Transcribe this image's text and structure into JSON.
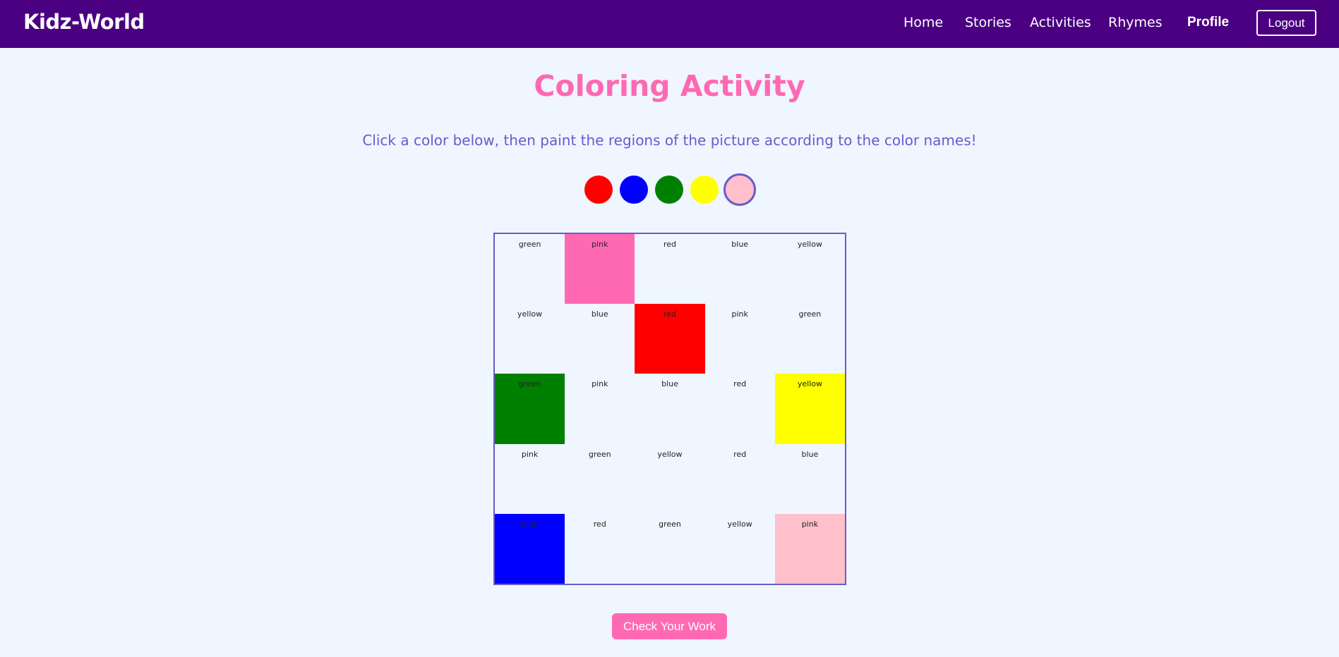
{
  "navbar": {
    "logo": "Kidz-World",
    "links": [
      "Home",
      "Stories",
      "Activities",
      "Rhymes"
    ],
    "profile": "Profile",
    "logout": "Logout"
  },
  "main": {
    "title": "Coloring Activity",
    "instructions": "Click a color below, then paint the regions of the picture according to the color names!",
    "check_button": "Check Your Work"
  },
  "palette": {
    "colors": [
      {
        "name": "red",
        "hex": "#ff0000"
      },
      {
        "name": "blue",
        "hex": "#0000ff"
      },
      {
        "name": "green",
        "hex": "#008000"
      },
      {
        "name": "yellow",
        "hex": "#ffff00"
      },
      {
        "name": "pink",
        "hex": "#ffc0cb"
      }
    ],
    "selected": "pink"
  },
  "grid": {
    "cells": [
      {
        "label": "green",
        "fill": null
      },
      {
        "label": "pink",
        "fill": "#ff69b4"
      },
      {
        "label": "red",
        "fill": null
      },
      {
        "label": "blue",
        "fill": null
      },
      {
        "label": "yellow",
        "fill": null
      },
      {
        "label": "yellow",
        "fill": null
      },
      {
        "label": "blue",
        "fill": null
      },
      {
        "label": "red",
        "fill": "#ff0000"
      },
      {
        "label": "pink",
        "fill": null
      },
      {
        "label": "green",
        "fill": null
      },
      {
        "label": "green",
        "fill": "#008000"
      },
      {
        "label": "pink",
        "fill": null
      },
      {
        "label": "blue",
        "fill": null
      },
      {
        "label": "red",
        "fill": null
      },
      {
        "label": "yellow",
        "fill": "#ffff00"
      },
      {
        "label": "pink",
        "fill": null
      },
      {
        "label": "green",
        "fill": null
      },
      {
        "label": "yellow",
        "fill": null
      },
      {
        "label": "red",
        "fill": null
      },
      {
        "label": "blue",
        "fill": null
      },
      {
        "label": "blue",
        "fill": "#0000ff"
      },
      {
        "label": "red",
        "fill": null
      },
      {
        "label": "green",
        "fill": null
      },
      {
        "label": "yellow",
        "fill": null
      },
      {
        "label": "pink",
        "fill": "#ffc0cb"
      }
    ]
  },
  "colors": {
    "navbar_bg": "#4b0082",
    "page_bg": "#eff6ff",
    "title": "#ff69b4",
    "accent": "#6a5acd",
    "button_bg": "#ff69b4"
  }
}
